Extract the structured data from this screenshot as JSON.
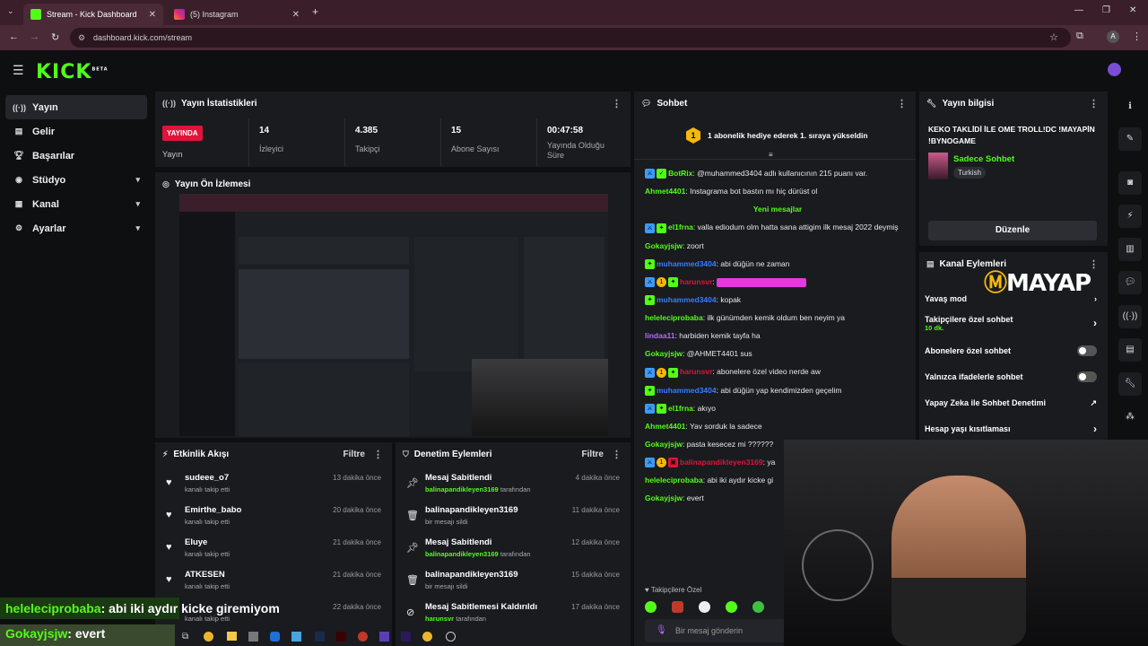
{
  "browser": {
    "tabs": [
      {
        "title": "Stream - Kick Dashboard",
        "active": true
      },
      {
        "title": "(5) Instagram",
        "active": false
      }
    ],
    "url": "dashboard.kick.com/stream",
    "profile_initial": "A"
  },
  "app": {
    "logo": "KICK",
    "logo_badge": "BETA",
    "nav": [
      {
        "label": "Yayın",
        "icon": "broadcast-icon",
        "active": true
      },
      {
        "label": "Gelir",
        "icon": "revenue-icon"
      },
      {
        "label": "Başarılar",
        "icon": "trophy-icon"
      },
      {
        "label": "Stüdyo",
        "icon": "studio-icon",
        "expandable": true
      },
      {
        "label": "Kanal",
        "icon": "channel-icon",
        "expandable": true
      },
      {
        "label": "Ayarlar",
        "icon": "gear-icon",
        "expandable": true
      }
    ]
  },
  "stats": {
    "title": "Yayın İstatistikleri",
    "live_badge": "YAYINDA",
    "stream_label": "Yayın",
    "items": [
      {
        "value": "14",
        "label": "İzleyici"
      },
      {
        "value": "4.385",
        "label": "Takipçi"
      },
      {
        "value": "15",
        "label": "Abone Sayısı"
      },
      {
        "value": "00:47:58",
        "label": "Yayında Olduğu Süre"
      }
    ]
  },
  "preview": {
    "title": "Yayın Ön İzlemesi"
  },
  "activity": {
    "title": "Etkinlik Akışı",
    "filter": "Filtre",
    "items": [
      {
        "name": "sudeee_o7",
        "sub": "kanalı takip etti",
        "time": "13 dakika önce"
      },
      {
        "name": "Emirthe_babo",
        "sub": "kanalı takip etti",
        "time": "20 dakika önce"
      },
      {
        "name": "Eluye",
        "sub": "kanalı takip etti",
        "time": "21 dakika önce"
      },
      {
        "name": "ATKESEN",
        "sub": "kanalı takip etti",
        "time": "21 dakika önce"
      },
      {
        "name": "",
        "sub": "kanalı takip etti",
        "time": "22 dakika önce"
      }
    ]
  },
  "moderation": {
    "title": "Denetim Eylemleri",
    "filter": "Filtre",
    "items": [
      {
        "name": "Mesaj Sabitlendi",
        "user": "balinapandikleyen3169",
        "suffix": "tarafından",
        "time": "4 dakika önce",
        "icon": "pin-icon"
      },
      {
        "name": "balinapandikleyen3169",
        "user": "",
        "suffix": "bir mesajı sildi",
        "time": "11 dakika önce",
        "icon": "trash-icon"
      },
      {
        "name": "Mesaj Sabitlendi",
        "user": "balinapandikleyen3169",
        "suffix": "tarafından",
        "time": "12 dakika önce",
        "icon": "pin-icon"
      },
      {
        "name": "balinapandikleyen3169",
        "user": "",
        "suffix": "bir mesajı sildi",
        "time": "15 dakika önce",
        "icon": "trash-icon"
      },
      {
        "name": "Mesaj Sabitlemesi Kaldırıldı",
        "user": "harunsvr",
        "suffix": "tarafından",
        "time": "17 dakika önce",
        "icon": "unpin-icon"
      }
    ]
  },
  "chat": {
    "title": "Sohbet",
    "pinned": "1 abonelik hediye ederek 1. sıraya yükseldin",
    "pinned_rank": "1",
    "new_messages": "Yeni mesajlar",
    "lines": [
      {
        "user": "BotRix",
        "color": "#53fc18",
        "text": "@muhammed3404 adlı kullanıcının 215 puanı var."
      },
      {
        "user": "Ahmet4401",
        "color": "#53fc18",
        "text": "Instagrama bot bastın mı hiç dürüst ol"
      },
      {
        "user": "el1frna",
        "color": "#53fc18",
        "text": "valla ediodum olm hatta sana attigim ilk mesaj 2022 deymiş"
      },
      {
        "user": "Gokayjsjw",
        "color": "#53fc18",
        "text": "zoort"
      },
      {
        "user": "muhammed3404",
        "color": "#3b7bff",
        "text": "abi düğün ne zaman"
      },
      {
        "user": "harunsvr",
        "color": "#e0143a",
        "text": ""
      },
      {
        "user": "muhammed3404",
        "color": "#3b7bff",
        "text": "kopak"
      },
      {
        "user": "heleleciprobaba",
        "color": "#53fc18",
        "text": "ilk günümden kemik oldum ben neyim ya"
      },
      {
        "user": "lindaa11",
        "color": "#b36bff",
        "text": "harbiden kemik tayfa ha"
      },
      {
        "user": "Gokayjsjw",
        "color": "#53fc18",
        "text": "@AHMET4401 sus"
      },
      {
        "user": "harunsvr",
        "color": "#e0143a",
        "text": "abonelere özel video nerde aw"
      },
      {
        "user": "muhammed3404",
        "color": "#3b7bff",
        "text": "abi düğün yap kendimizden geçelim"
      },
      {
        "user": "el1frna",
        "color": "#53fc18",
        "text": "akıyo"
      },
      {
        "user": "Ahmet4401",
        "color": "#53fc18",
        "text": "Yav sorduk la sadece"
      },
      {
        "user": "Gokayjsjw",
        "color": "#53fc18",
        "text": "pasta kesecez mi ??????"
      },
      {
        "user": "balinapandikleyen3169",
        "color": "#e0143a",
        "text": "ya"
      },
      {
        "user": "heleleciprobaba",
        "color": "#53fc18",
        "text": "abi iki aydır kicke gi"
      },
      {
        "user": "Gokayjsjw",
        "color": "#53fc18",
        "text": "evert"
      }
    ],
    "mode_label": "Takipçilere Özel",
    "input_placeholder": "Bir mesaj gönderin"
  },
  "stream_info": {
    "title": "Yayın bilgisi",
    "stream_title": "KEKO TAKLİDİ İLE OME TROLL!DC !MAYAPİN !BYNOGAME",
    "category": "Sadece Sohbet",
    "tag": "Turkish",
    "edit": "Düzenle"
  },
  "channel_actions": {
    "title": "Kanal Eylemleri",
    "brand_overlay": "MAYAP",
    "items": [
      {
        "label": "Yavaş mod",
        "sub": "",
        "control": "chevron"
      },
      {
        "label": "Takipçilere özel sohbet",
        "sub": "10 dk.",
        "control": "chevron"
      },
      {
        "label": "Abonelere özel sohbet",
        "sub": "",
        "control": "toggle"
      },
      {
        "label": "Yalnızca ifadelerle sohbet",
        "sub": "",
        "control": "toggle"
      },
      {
        "label": "Yapay Zeka ile Sohbet Denetimi",
        "sub": "",
        "control": "external"
      },
      {
        "label": "Hesap yaşı kısıtlaması",
        "sub": "",
        "control": "chevron"
      }
    ]
  },
  "overlay_chat": [
    {
      "user": "heleleciprobaba",
      "text": ": abi iki aydır kicke giremiyom"
    },
    {
      "user": "Gokayjsjw",
      "text": ": evert"
    }
  ],
  "colors": {
    "accent": "#53fc18",
    "live": "#e0143a",
    "panel": "#191b1f",
    "bg": "#0e0f11"
  }
}
